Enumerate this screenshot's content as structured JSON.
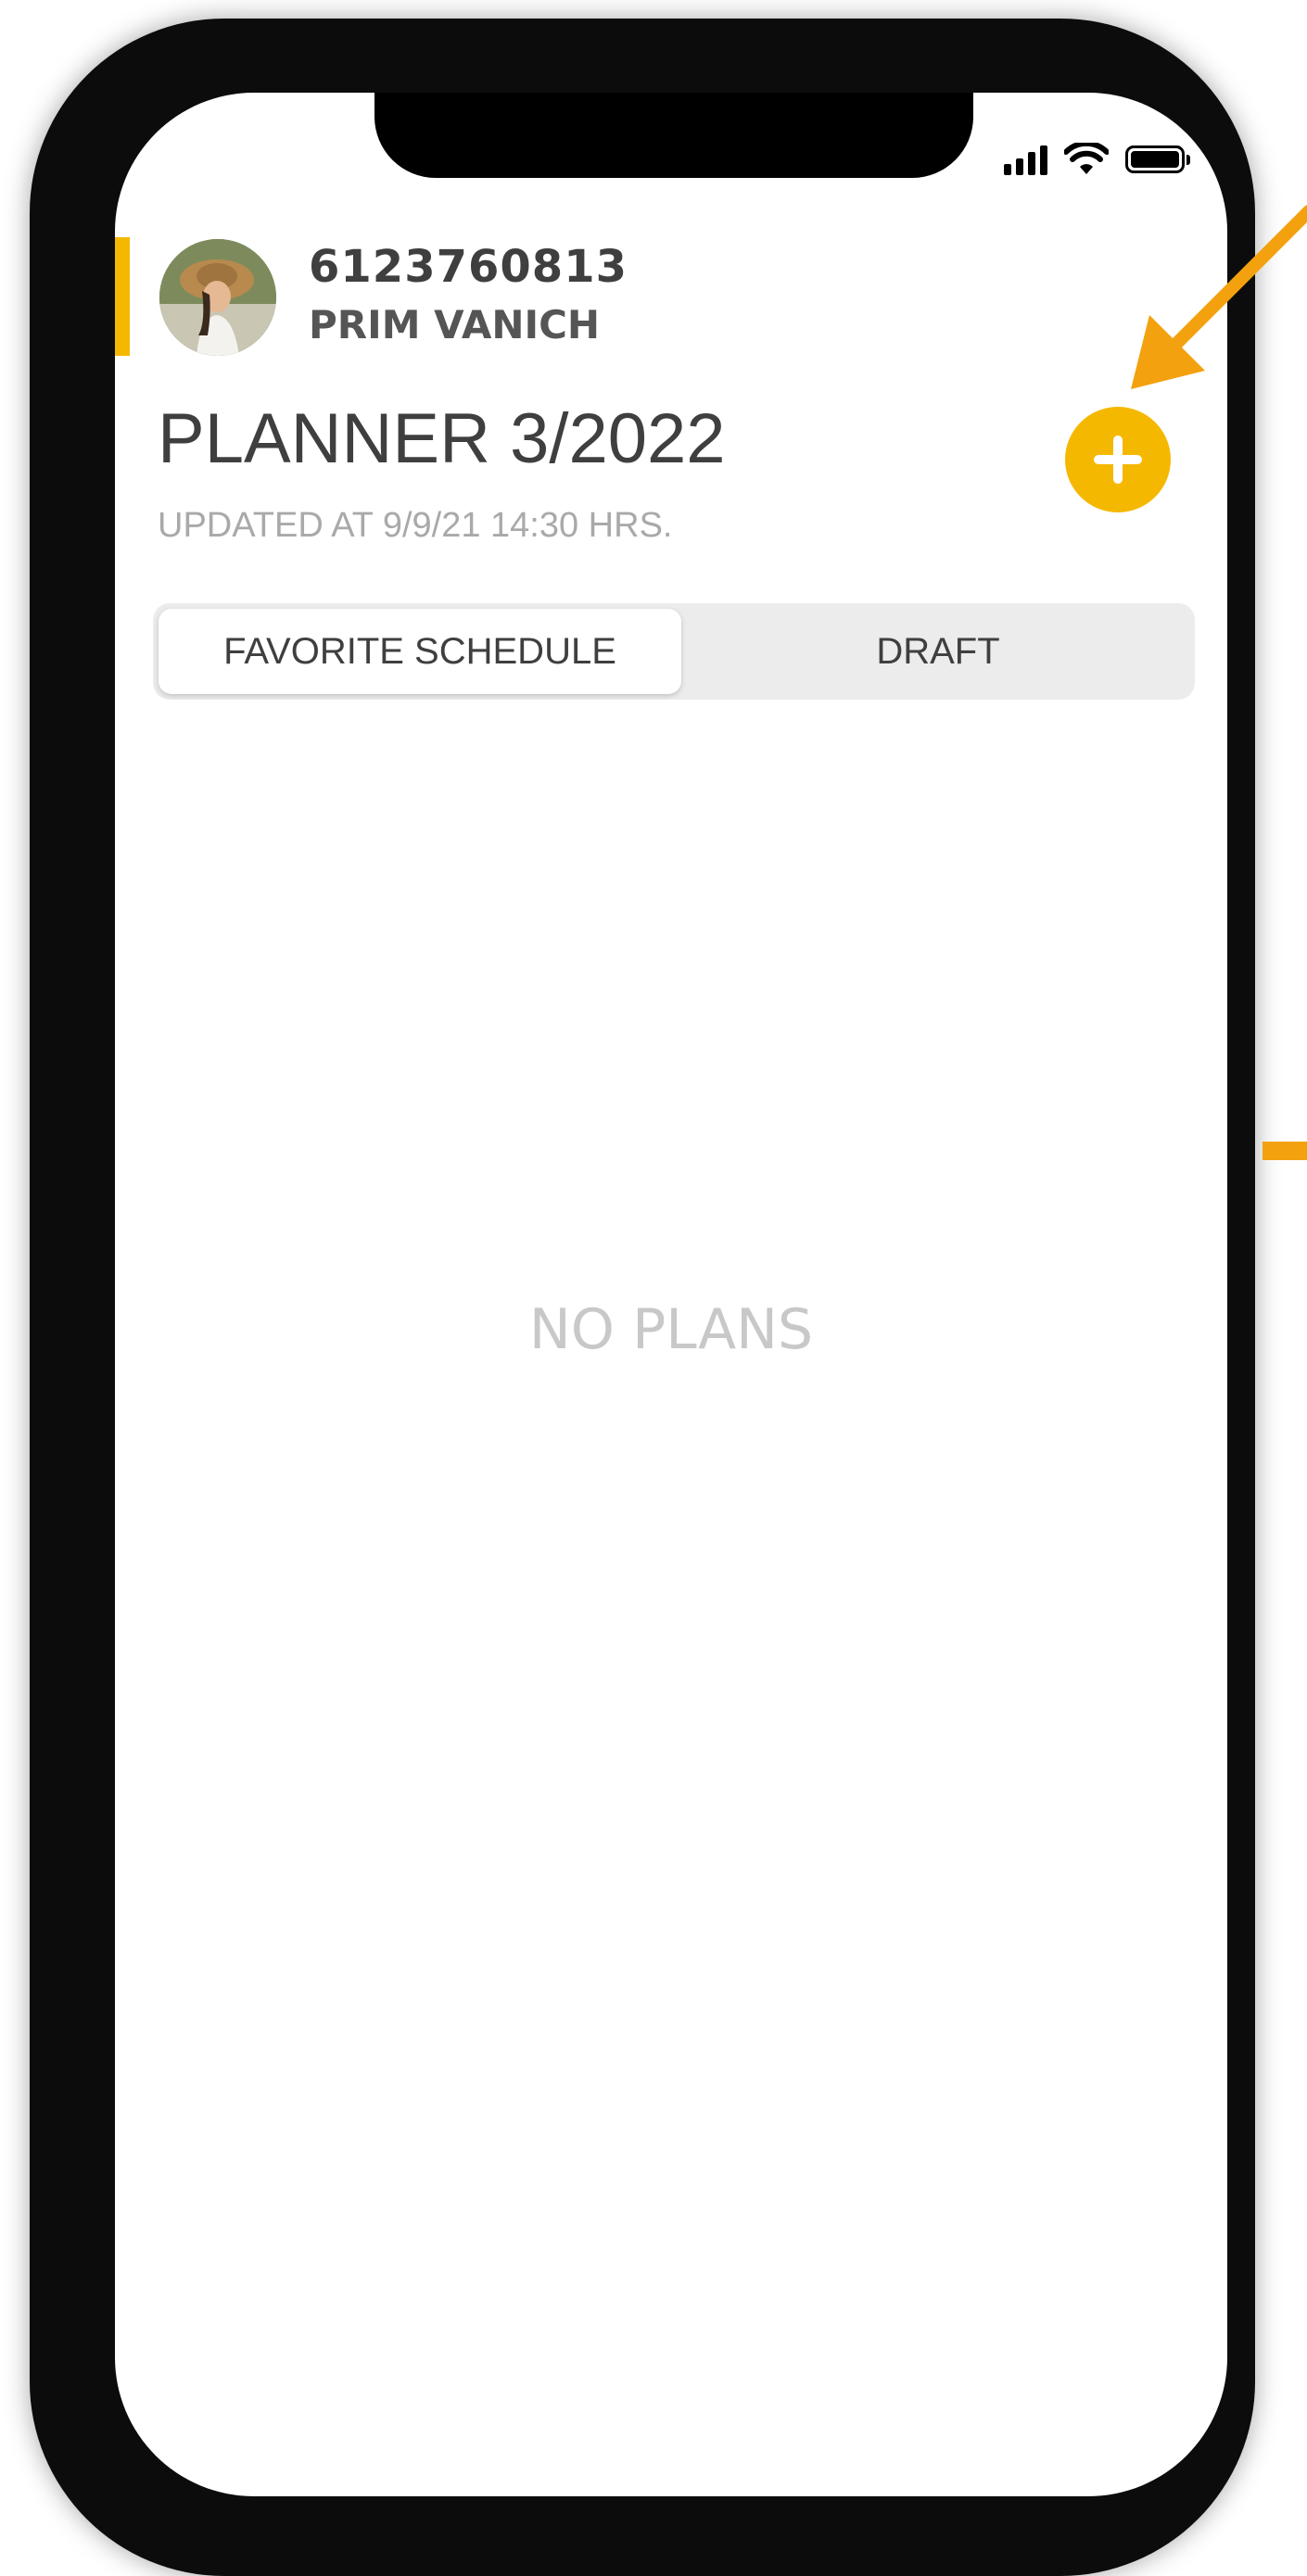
{
  "profile": {
    "id": "6123760813",
    "name": "PRIM VANICH",
    "avatar_icon": "user-photo"
  },
  "planner": {
    "title": "PLANNER 3/2022",
    "updated": "UPDATED AT 9/9/21 14:30 HRS.",
    "add_button_icon": "plus-icon"
  },
  "tabs": [
    {
      "label": "FAVORITE SCHEDULE",
      "active": true
    },
    {
      "label": "DRAFT",
      "active": false
    }
  ],
  "empty_state": {
    "text": "NO PLANS"
  },
  "colors": {
    "accent": "#F5B800",
    "annotation": "#F4A10F",
    "frame": "#0c0c0c",
    "text_dark": "#3f3f3f",
    "text_muted": "#a9a9a9",
    "empty_text": "#c8c8c8",
    "segment_bg": "#ececec"
  }
}
